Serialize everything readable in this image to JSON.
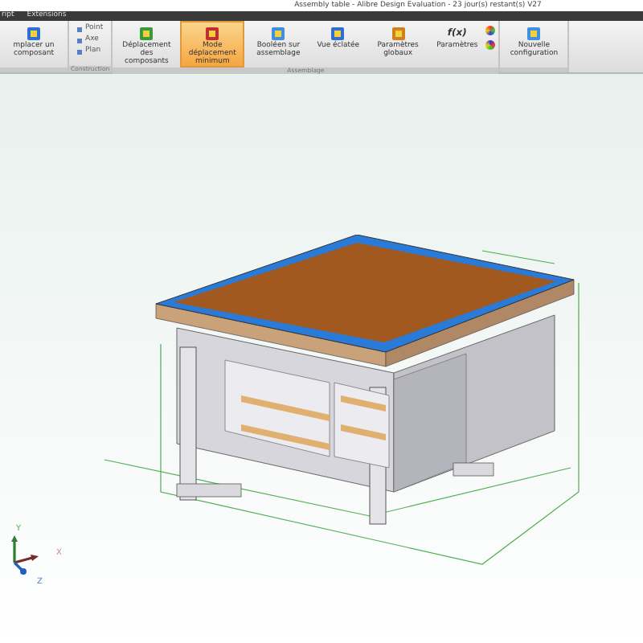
{
  "window": {
    "title": "Assembly table - Alibre Design  Evaluation - 23 jour(s) restant(s) V27"
  },
  "menu": [
    "ript",
    "Extensions"
  ],
  "ribbon": {
    "groups": [
      {
        "items": [
          {
            "kind": "large",
            "label": "mplacer un composant",
            "selected": false
          }
        ]
      },
      {
        "label": "Construction",
        "items": [
          {
            "kind": "small",
            "labels": [
              "Point",
              "Axe",
              "Plan"
            ]
          }
        ]
      },
      {
        "label": "Assemblage",
        "items": [
          {
            "kind": "large",
            "label": "Déplacement des composants",
            "selected": false
          },
          {
            "kind": "large",
            "label": "Mode déplacement minimum",
            "selected": true
          },
          {
            "kind": "large",
            "label": "Booléen sur assemblage",
            "selected": false
          },
          {
            "kind": "large",
            "label": "Vue éclatée",
            "selected": false
          },
          {
            "kind": "large",
            "label": "Paramètres globaux",
            "selected": false
          },
          {
            "kind": "fx",
            "glyph": "f(x)",
            "label": "Paramètres",
            "selected": false
          },
          {
            "kind": "icons"
          }
        ]
      },
      {
        "items": [
          {
            "kind": "large",
            "label": "Nouvelle configuration",
            "selected": false
          }
        ]
      }
    ]
  },
  "axes": {
    "x": "X",
    "y": "Y",
    "z": "Z"
  }
}
